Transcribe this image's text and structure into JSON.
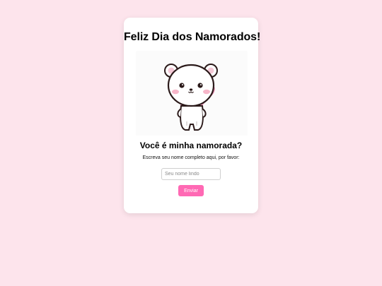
{
  "card": {
    "title": "Feliz Dia dos Namorados!",
    "question": "Você é minha namorada?",
    "instruction": "Escreva seu nome completo aqui, por favor:"
  },
  "form": {
    "name_placeholder": "Seu nome lindo",
    "name_value": "",
    "submit_label": "Enviar"
  },
  "illustration": {
    "icon": "cute-bear-holding-heart-icon"
  },
  "colors": {
    "page_background": "#fde4ec",
    "card_background": "#ffffff",
    "button_background": "#ff69b4",
    "button_text": "#ffffff"
  }
}
